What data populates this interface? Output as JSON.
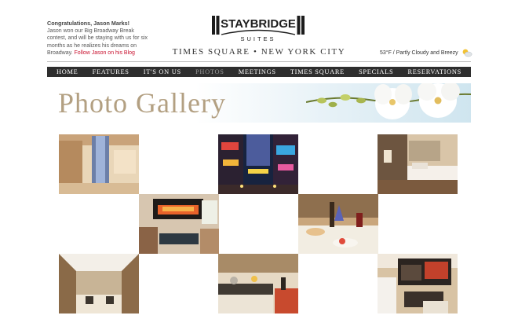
{
  "promo": {
    "headline": "Congratulations, Jason Marks!",
    "body": "Jason won our Big Broadway Break contest, and will be staying with us for six months as he realizes his dreams on Broadway.",
    "link": "Follow Jason on his Blog"
  },
  "brand": {
    "name": "STAYBRIDGE",
    "sub": "SUITES",
    "location": "TIMES SQUARE • NEW YORK CITY"
  },
  "weather": {
    "text": "53°F / Partly Cloudy and Breezy",
    "icon": "partly-cloudy-icon"
  },
  "nav": {
    "items": [
      "HOME",
      "FEATURES",
      "IT'S ON US",
      "PHOTOS",
      "MEETINGS",
      "TIMES SQUARE",
      "SPECIALS",
      "RESERVATIONS"
    ],
    "active": "PHOTOS"
  },
  "gallery": {
    "title": "Photo Gallery",
    "photos": [
      {
        "subject": "lobby"
      },
      {
        "subject": "times-square-at-night"
      },
      {
        "subject": "guest-bedroom"
      },
      {
        "subject": "fireplace-lounge"
      },
      {
        "subject": "breakfast-table"
      },
      {
        "subject": "atrium-dining"
      },
      {
        "subject": "suite-kitchen"
      },
      {
        "subject": "living-area"
      }
    ]
  },
  "colors": {
    "nav_bg": "#2e2e2e",
    "title": "#b3a082",
    "link": "#c8102e",
    "banner_sky": "#cfe5ef"
  }
}
